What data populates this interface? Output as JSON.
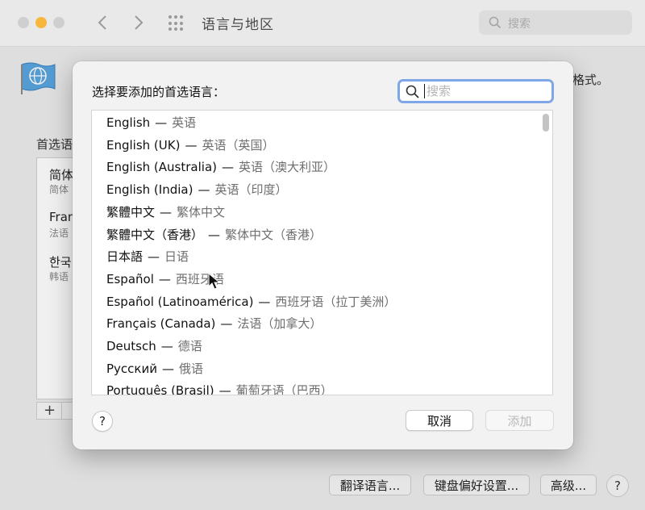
{
  "window": {
    "title": "语言与地区",
    "search_placeholder": "搜索",
    "accent_traffic": "#f5b83d"
  },
  "background_pane": {
    "format_text": "格式。",
    "preferred_label": "首选语",
    "preferred_items": [
      {
        "name": "简体",
        "sub": "简体"
      },
      {
        "name": "Fran",
        "sub": "法语"
      },
      {
        "name": "한국",
        "sub": "韩语"
      }
    ],
    "buttons": {
      "translation": "翻译语言...",
      "keyboard": "键盘偏好设置...",
      "advanced": "高级...",
      "help": "?"
    }
  },
  "dialog": {
    "title": "选择要添加的首选语言：",
    "search_placeholder": "搜索",
    "languages": [
      {
        "name": "English",
        "zh": "英语"
      },
      {
        "name": "English (UK)",
        "zh": "英语（英国）"
      },
      {
        "name": "English (Australia)",
        "zh": "英语（澳大利亚）"
      },
      {
        "name": "English (India)",
        "zh": "英语（印度）"
      },
      {
        "name": "繁體中文",
        "zh": "繁体中文"
      },
      {
        "name": "繁體中文（香港）",
        "zh": "繁体中文（香港）"
      },
      {
        "name": "日本語",
        "zh": "日语"
      },
      {
        "name": "Español",
        "zh": "西班牙语"
      },
      {
        "name": "Español (Latinoamérica)",
        "zh": "西班牙语（拉丁美洲）"
      },
      {
        "name": "Français (Canada)",
        "zh": "法语（加拿大）"
      },
      {
        "name": "Deutsch",
        "zh": "德语"
      },
      {
        "name": "Русский",
        "zh": "俄语"
      },
      {
        "name": "Português (Brasil)",
        "zh": "葡萄牙语（巴西）"
      }
    ],
    "separator": "—",
    "help_label": "?",
    "cancel_label": "取消",
    "add_label": "添加"
  }
}
